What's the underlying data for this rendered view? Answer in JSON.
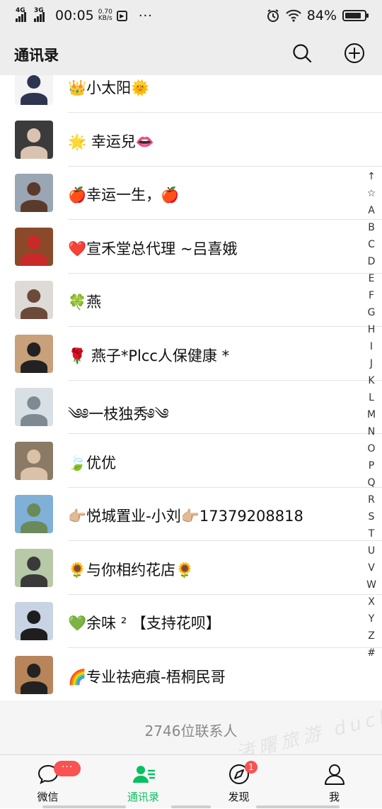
{
  "status_bar": {
    "net1": "4G",
    "net2": "3G",
    "time": "00:05",
    "speed_value": "0.70",
    "speed_unit": "KB/s",
    "more": "···",
    "battery": "84%",
    "battery_level": 0.84
  },
  "header": {
    "title": "通讯录",
    "search_icon": "search-icon",
    "add_icon": "plus-circle-icon"
  },
  "contacts": [
    {
      "name": "👑小太阳🌞",
      "avatar_bg": "#f4f4f4",
      "avatar_fg": "#2d3550"
    },
    {
      "name": "🌟 幸运兒👄",
      "avatar_bg": "#3b3b3b",
      "avatar_fg": "#d9c3b0"
    },
    {
      "name": "🍎幸运一生，🍎",
      "avatar_bg": "#9aa6b3",
      "avatar_fg": "#5a3a2a"
    },
    {
      "name": "❤️宣禾堂总代理 ~吕喜娥",
      "avatar_bg": "#8a4a2a",
      "avatar_fg": "#c82a2a"
    },
    {
      "name": "🍀燕",
      "avatar_bg": "#dedad6",
      "avatar_fg": "#6b4a3a"
    },
    {
      "name": "🌹 燕子*Plcc人保健康 *",
      "avatar_bg": "#c8a07a",
      "avatar_fg": "#222222"
    },
    {
      "name": "༄༅一枝独秀༅༄",
      "avatar_bg": "#d8e0e6",
      "avatar_fg": "#7d8a92"
    },
    {
      "name": "🍃优优",
      "avatar_bg": "#8a7a66",
      "avatar_fg": "#d9c2a8"
    },
    {
      "name": "👉🏼悦城置业-小刘👉🏼17379208818",
      "avatar_bg": "#7fb0d8",
      "avatar_fg": "#6a8a5a"
    },
    {
      "name": "🌻与你相约花店🌻",
      "avatar_bg": "#b7c9a6",
      "avatar_fg": "#3a3a3a"
    },
    {
      "name": "💚余味 ² 【支持花呗】",
      "avatar_bg": "#c8d4e4",
      "avatar_fg": "#1e1e1e"
    },
    {
      "name": "🌈专业祛疤痕-梧桐民哥",
      "avatar_bg": "#b8845a",
      "avatar_fg": "#222222"
    }
  ],
  "contact_count": "2746位联系人",
  "index_letters": [
    "↑",
    "☆",
    "A",
    "B",
    "C",
    "D",
    "E",
    "F",
    "G",
    "H",
    "I",
    "J",
    "K",
    "L",
    "M",
    "N",
    "O",
    "P",
    "Q",
    "R",
    "S",
    "T",
    "U",
    "V",
    "W",
    "X",
    "Y",
    "Z",
    "#"
  ],
  "tabs": [
    {
      "label": "微信",
      "icon": "chat-bubble-icon",
      "badge": "···"
    },
    {
      "label": "通讯录",
      "icon": "contacts-icon",
      "active": true
    },
    {
      "label": "发现",
      "icon": "compass-icon",
      "badge": "1"
    },
    {
      "label": "我",
      "icon": "person-icon"
    }
  ],
  "watermark": "渚曙旅游 duchen",
  "colors": {
    "accent": "#07c160",
    "badge": "#fa5151",
    "header_bg": "#ededed"
  }
}
